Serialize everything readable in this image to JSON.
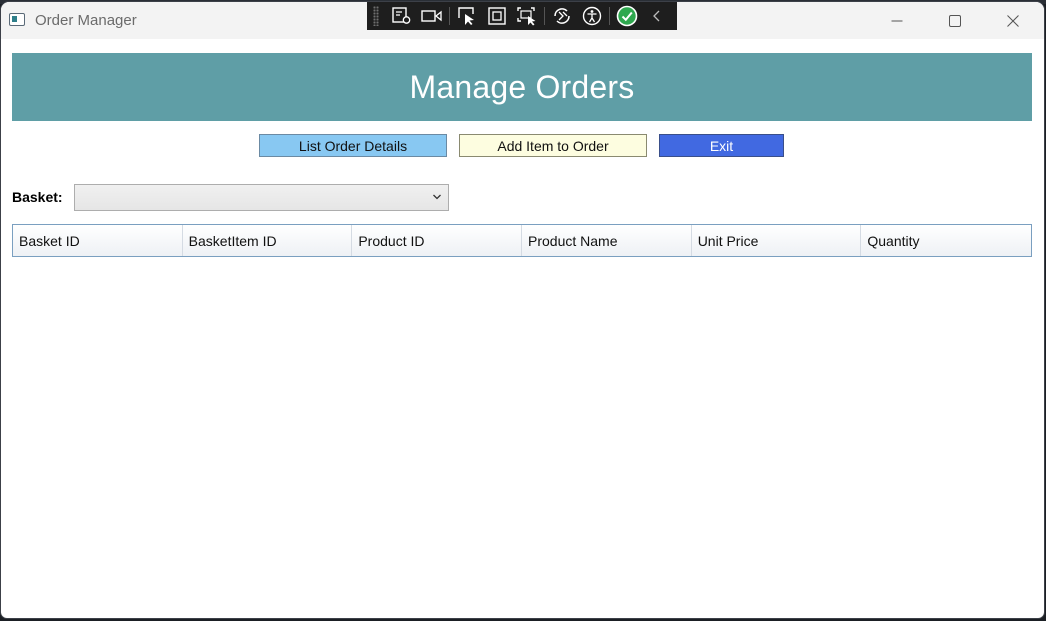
{
  "window": {
    "title": "Order Manager"
  },
  "header": {
    "title": "Manage Orders"
  },
  "toolbar": {
    "list_label": "List Order Details",
    "add_label": "Add Item to Order",
    "exit_label": "Exit"
  },
  "basket": {
    "label": "Basket:",
    "selected": ""
  },
  "grid": {
    "columns": [
      "Basket ID",
      "BasketItem ID",
      "Product ID",
      "Product Name",
      "Unit Price",
      "Quantity"
    ],
    "rows": []
  },
  "colors": {
    "banner": "#5f9ea6",
    "list_button": "#88c8f2",
    "add_button": "#fdfde0",
    "exit_button": "#4169e1"
  },
  "icons": {
    "app": "app-window-icon",
    "debug_tools": [
      "live-visual-tree-icon",
      "record-icon",
      "select-element-icon",
      "display-layout-adorners-icon",
      "track-focus-icon",
      "hot-reload-icon",
      "accessibility-icon",
      "binding-ok-icon",
      "collapse-chevron-icon"
    ]
  }
}
